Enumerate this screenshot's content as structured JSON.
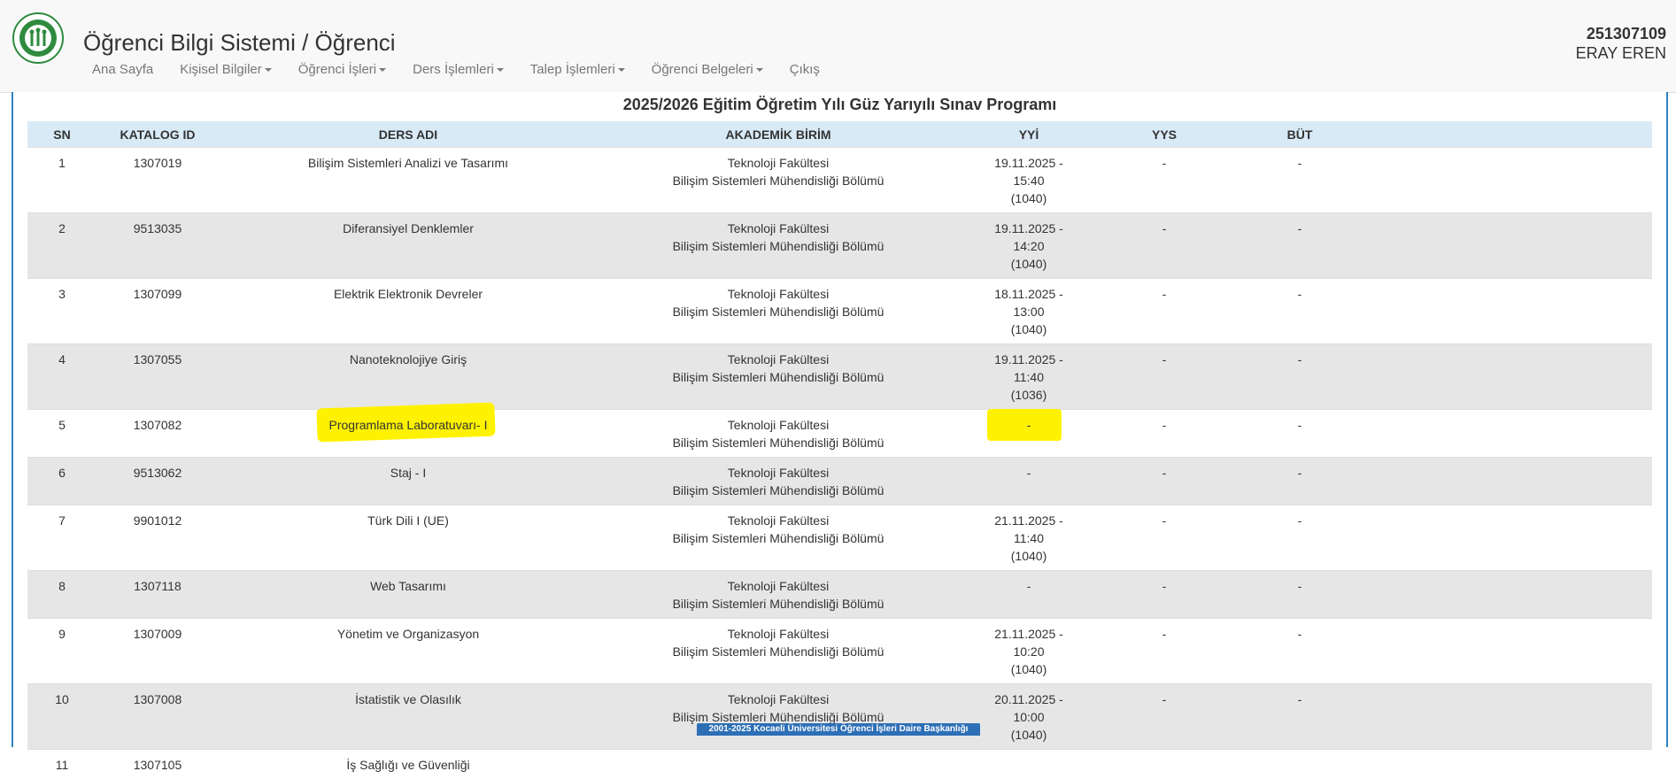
{
  "header": {
    "title": "Öğrenci Bilgi Sistemi / Öğrenci",
    "logo_text": "KOCAELİ ÜNİVERSİTESİ",
    "user_id": "251307109",
    "user_name": "ERAY EREN",
    "nav": [
      {
        "label": "Ana Sayfa",
        "dropdown": false
      },
      {
        "label": "Kişisel Bilgiler",
        "dropdown": true
      },
      {
        "label": "Öğrenci İşleri",
        "dropdown": true
      },
      {
        "label": "Ders İşlemleri",
        "dropdown": true
      },
      {
        "label": "Talep İşlemleri",
        "dropdown": true
      },
      {
        "label": "Öğrenci Belgeleri",
        "dropdown": true
      },
      {
        "label": "Çıkış",
        "dropdown": false
      }
    ]
  },
  "table": {
    "title": "2025/2026 Eğitim Öğretim Yılı Güz Yarıyılı Sınav Programı",
    "columns": [
      "SN",
      "KATALOG ID",
      "DERS ADI",
      "AKADEMİK BİRİM",
      "YYİ",
      "YYS",
      "BÜT"
    ],
    "rows": [
      {
        "sn": "1",
        "id": "1307019",
        "ders": "Bilişim Sistemleri Analizi ve Tasarımı",
        "birim1": "Teknoloji Fakültesi",
        "birim2": "Bilişim Sistemleri Mühendisliği Bölümü",
        "yyi": [
          "19.11.2025 -",
          "15:40",
          "(1040)"
        ],
        "yys": "-",
        "but": "-"
      },
      {
        "sn": "2",
        "id": "9513035",
        "ders": "Diferansiyel Denklemler",
        "birim1": "Teknoloji Fakültesi",
        "birim2": "Bilişim Sistemleri Mühendisliği Bölümü",
        "yyi": [
          "19.11.2025 -",
          "14:20",
          "(1040)"
        ],
        "yys": "-",
        "but": "-"
      },
      {
        "sn": "3",
        "id": "1307099",
        "ders": "Elektrik Elektronik Devreler",
        "birim1": "Teknoloji Fakültesi",
        "birim2": "Bilişim Sistemleri Mühendisliği Bölümü",
        "yyi": [
          "18.11.2025 -",
          "13:00",
          "(1040)"
        ],
        "yys": "-",
        "but": "-"
      },
      {
        "sn": "4",
        "id": "1307055",
        "ders": "Nanoteknolojiye Giriş",
        "birim1": "Teknoloji Fakültesi",
        "birim2": "Bilişim Sistemleri Mühendisliği Bölümü",
        "yyi": [
          "19.11.2025 -",
          "11:40",
          "(1036)"
        ],
        "yys": "-",
        "but": "-"
      },
      {
        "sn": "5",
        "id": "1307082",
        "ders": "Programlama Laboratuvarı- I",
        "birim1": "Teknoloji Fakültesi",
        "birim2": "Bilişim Sistemleri Mühendisliği Bölümü",
        "yyi": [
          "-"
        ],
        "yys": "-",
        "but": "-",
        "highlight": true
      },
      {
        "sn": "6",
        "id": "9513062",
        "ders": "Staj - I",
        "birim1": "Teknoloji Fakültesi",
        "birim2": "Bilişim Sistemleri Mühendisliği Bölümü",
        "yyi": [
          "-"
        ],
        "yys": "-",
        "but": "-"
      },
      {
        "sn": "7",
        "id": "9901012",
        "ders": "Türk Dili I (UE)",
        "birim1": "Teknoloji Fakültesi",
        "birim2": "Bilişim Sistemleri Mühendisliği Bölümü",
        "yyi": [
          "21.11.2025 -",
          "11:40",
          "(1040)"
        ],
        "yys": "-",
        "but": "-"
      },
      {
        "sn": "8",
        "id": "1307118",
        "ders": "Web Tasarımı",
        "birim1": "Teknoloji Fakültesi",
        "birim2": "Bilişim Sistemleri Mühendisliği Bölümü",
        "yyi": [
          "-"
        ],
        "yys": "-",
        "but": "-"
      },
      {
        "sn": "9",
        "id": "1307009",
        "ders": "Yönetim ve Organizasyon",
        "birim1": "Teknoloji Fakültesi",
        "birim2": "Bilişim Sistemleri Mühendisliği Bölümü",
        "yyi": [
          "21.11.2025 -",
          "10:20",
          "(1040)"
        ],
        "yys": "-",
        "but": "-"
      },
      {
        "sn": "10",
        "id": "1307008",
        "ders": "İstatistik ve Olasılık",
        "birim1": "Teknoloji Fakültesi",
        "birim2": "Bilişim Sistemleri Mühendisliği Bölümü",
        "yyi": [
          "20.11.2025 -",
          "10:00",
          "(1040)"
        ],
        "yys": "-",
        "but": "-"
      },
      {
        "sn": "11",
        "id": "1307105",
        "ders": "İş Sağlığı ve Güvenliği",
        "birim1": "",
        "birim2": "",
        "yyi": [
          ""
        ],
        "yys": "",
        "but": ""
      }
    ]
  },
  "footer": {
    "text": "2001-2025 Kocaeli Üniversitesi Öğrenci İşleri Daire Başkanlığı"
  },
  "colors": {
    "accent_blue": "#2d83c4",
    "header_row": "#d9eaf7",
    "highlight": "#fff200",
    "logo_green": "#2e8b3e"
  }
}
